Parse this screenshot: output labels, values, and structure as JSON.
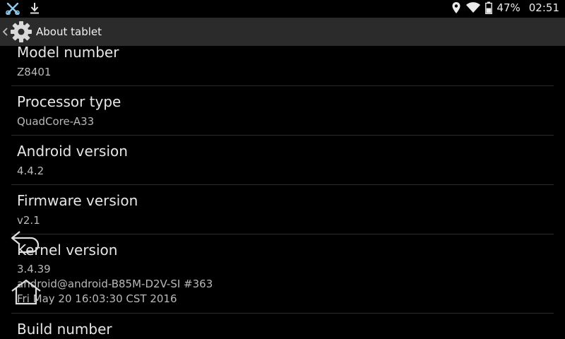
{
  "status_bar": {
    "left_icons": [
      "tools-icon",
      "download-icon"
    ],
    "right_icons": [
      "location-icon",
      "wifi-icon",
      "battery-icon"
    ],
    "battery": "47%",
    "time": "02:51"
  },
  "action_bar": {
    "title": "About tablet",
    "icon": "settings-gear-icon",
    "background": "#2b2b2b"
  },
  "items": [
    {
      "title": "Model number",
      "summary": "Z8401"
    },
    {
      "title": "Processor type",
      "summary": "QuadCore-A33"
    },
    {
      "title": "Android version",
      "summary": "4.4.2"
    },
    {
      "title": "Firmware version",
      "summary": "v2.1"
    },
    {
      "title": "Kernel version",
      "summary": "3.4.39\nandroid@android-B85M-D2V-SI #363\nFri May 20 16:03:30 CST 2016"
    },
    {
      "title": "Build number",
      "summary": ""
    }
  ],
  "overlay_nav": [
    "back-icon",
    "home-icon"
  ]
}
